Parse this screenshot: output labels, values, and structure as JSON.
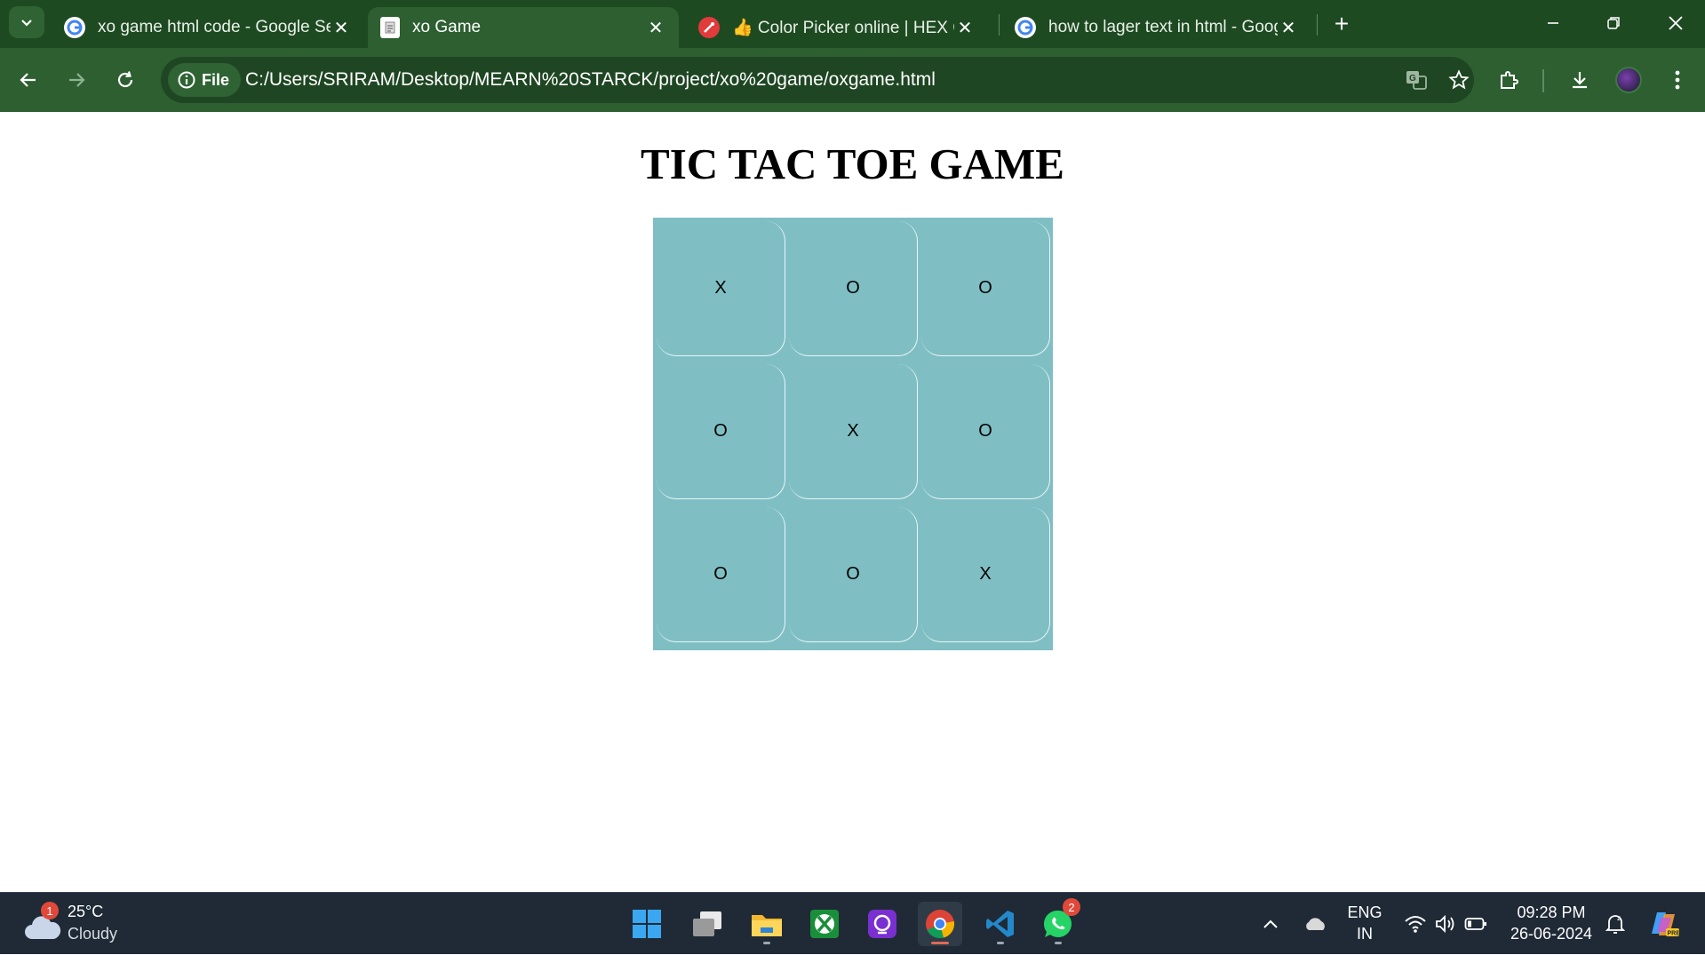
{
  "browser": {
    "tabs": [
      {
        "title": "xo game html code - Google Se",
        "favicon": "google-icon",
        "active": false
      },
      {
        "title": "xo Game",
        "favicon": "page-icon",
        "active": true
      },
      {
        "title": "👍 Color Picker online | HEX Co",
        "favicon": "color-picker-icon",
        "active": false
      },
      {
        "title": "how to lager text in html - Goog",
        "favicon": "google-icon",
        "active": false
      }
    ],
    "address": {
      "scheme_label": "File",
      "url": "C:/Users/SRIRAM/Desktop/MEARN%20STARCK/project/xo%20game/oxgame.html"
    }
  },
  "page": {
    "heading": "TIC TAC TOE GAME",
    "board": [
      [
        "X",
        "O",
        "O"
      ],
      [
        "O",
        "X",
        "O"
      ],
      [
        "O",
        "O",
        "X"
      ]
    ],
    "colors": {
      "board_background": "#7fbfc4",
      "cell_border": "#e9f5f6"
    }
  },
  "taskbar": {
    "weather": {
      "temperature": "25°C",
      "condition": "Cloudy",
      "badge": "1"
    },
    "apps": [
      {
        "name": "start-icon"
      },
      {
        "name": "task-view-icon"
      },
      {
        "name": "file-explorer-icon"
      },
      {
        "name": "xbox-icon"
      },
      {
        "name": "clipchamp-icon"
      },
      {
        "name": "chrome-icon",
        "active": true
      },
      {
        "name": "vscode-icon"
      },
      {
        "name": "whatsapp-icon",
        "badge": "2"
      }
    ],
    "language": {
      "line1": "ENG",
      "line2": "IN"
    },
    "clock": {
      "time": "09:28 PM",
      "date": "26-06-2024"
    }
  },
  "theme": {
    "tabstrip": "#1e4a22",
    "toolbar": "#2d5f31",
    "taskbar": "#1f2a36"
  }
}
